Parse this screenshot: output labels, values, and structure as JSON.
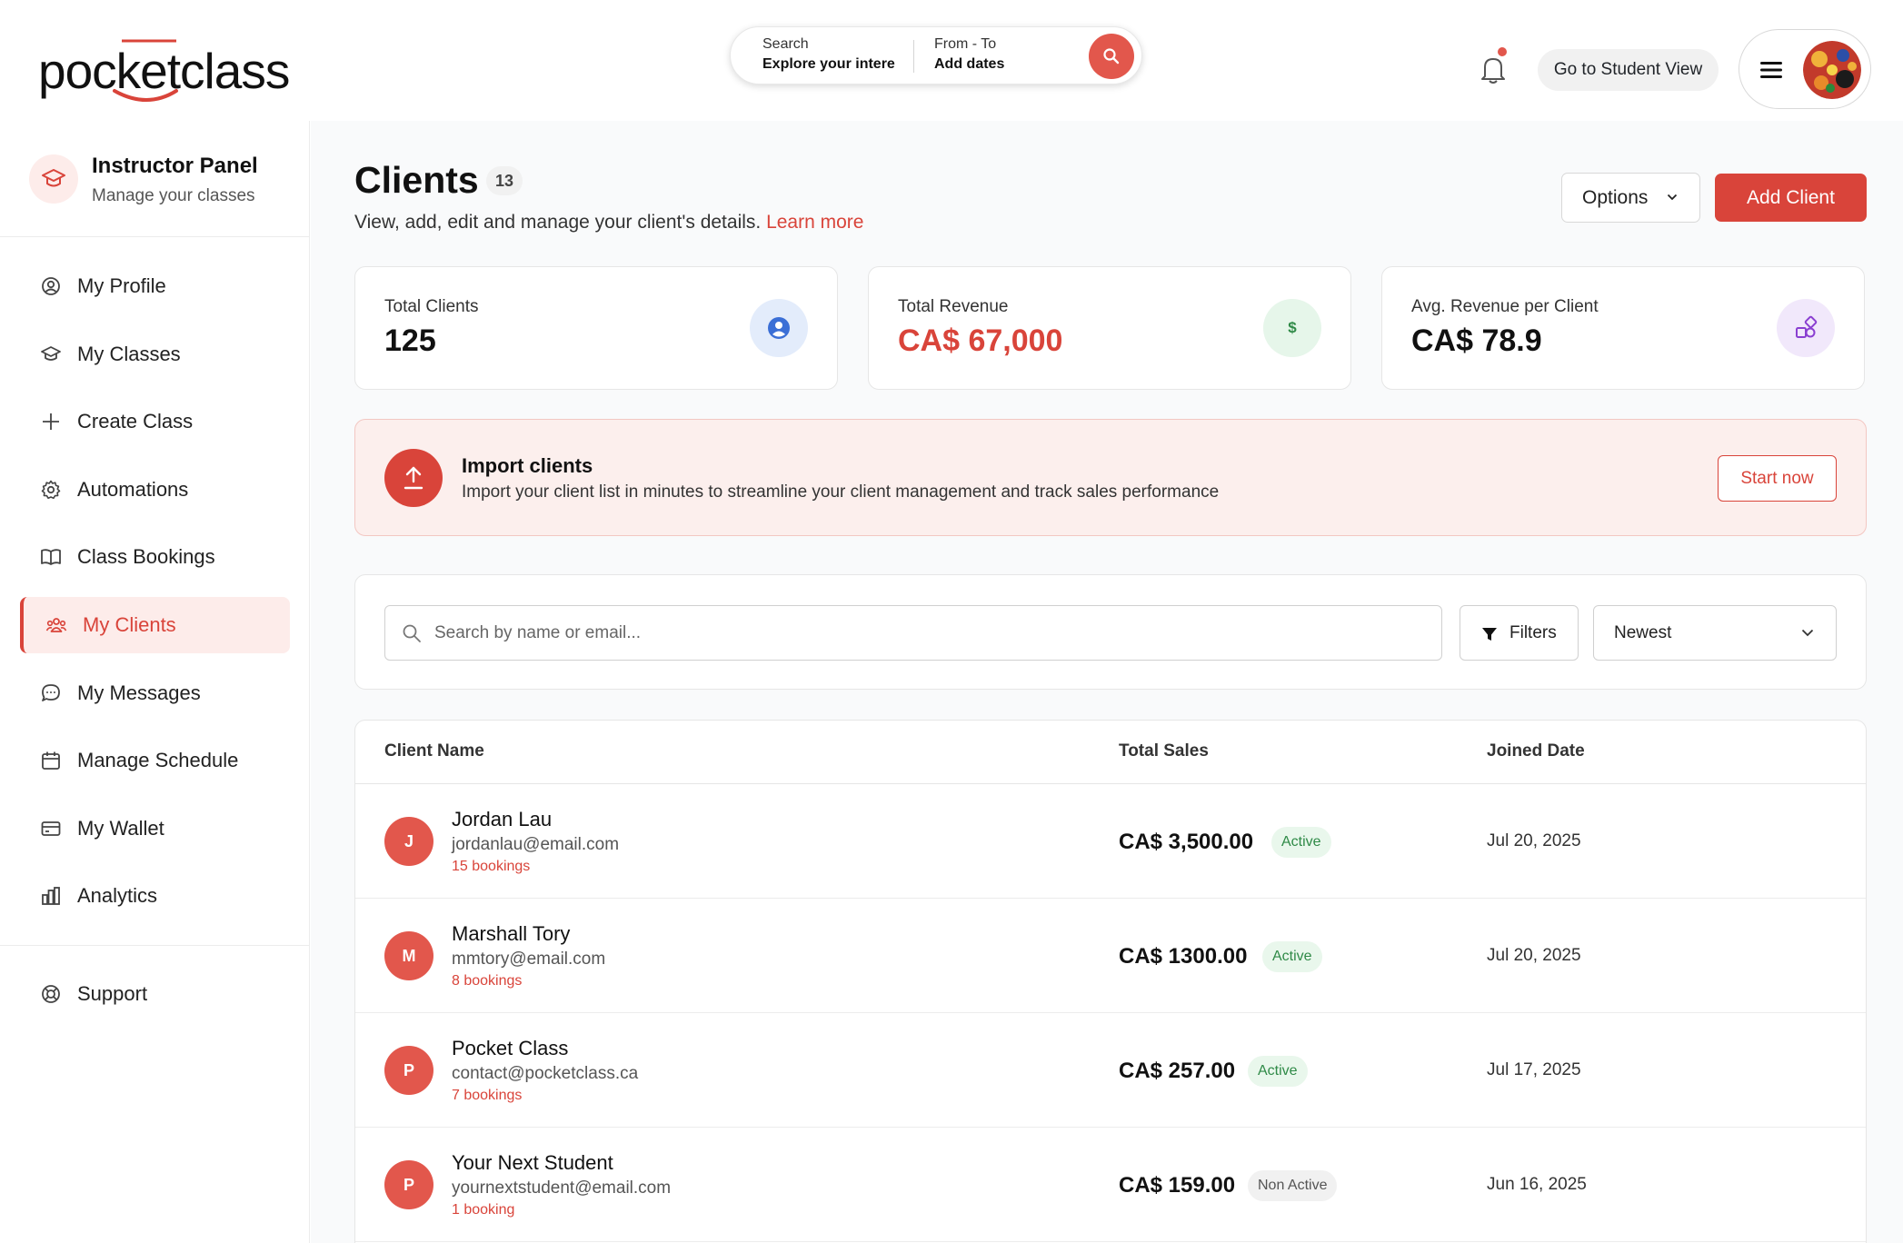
{
  "header": {
    "logo_text": "pocketclass",
    "search_label": "Search",
    "search_value": "Explore your intere",
    "dates_label": "From - To",
    "dates_value": "Add dates",
    "student_view_label": "Go to Student View"
  },
  "sidebar": {
    "panel_title": "Instructor Panel",
    "panel_subtitle": "Manage your classes",
    "items": [
      {
        "label": "My Profile",
        "icon": "user-circle-icon"
      },
      {
        "label": "My Classes",
        "icon": "graduation-cap-icon"
      },
      {
        "label": "Create Class",
        "icon": "plus-icon"
      },
      {
        "label": "Automations",
        "icon": "gear-icon"
      },
      {
        "label": "Class Bookings",
        "icon": "book-open-icon"
      },
      {
        "label": "My Clients",
        "icon": "users-icon",
        "active": true
      },
      {
        "label": "My Messages",
        "icon": "chat-bubble-icon"
      },
      {
        "label": "Manage Schedule",
        "icon": "calendar-icon"
      },
      {
        "label": "My Wallet",
        "icon": "wallet-icon"
      },
      {
        "label": "Analytics",
        "icon": "bar-chart-icon"
      }
    ],
    "support_label": "Support"
  },
  "main": {
    "title": "Clients",
    "count": "13",
    "subtitle": "View, add, edit and manage your client's details.",
    "learn_more": "Learn more",
    "options_label": "Options",
    "add_client_label": "Add Client",
    "stats": [
      {
        "label": "Total Clients",
        "value": "125",
        "icon": "user-circle-icon",
        "color": "#3b6fd6"
      },
      {
        "label": "Total Revenue",
        "value": "CA$ 67,000",
        "icon": "dollar-icon",
        "color": "#2f8a47"
      },
      {
        "label": "Avg. Revenue per Client",
        "value": "CA$ 78.9",
        "icon": "shapes-icon",
        "color": "#8a3fd1"
      }
    ],
    "import": {
      "title": "Import clients",
      "description": "Import your client list in minutes to streamline your client management and track sales performance",
      "button": "Start now"
    },
    "search_placeholder": "Search by name or email...",
    "filters_label": "Filters",
    "sort_value": "Newest",
    "table": {
      "headers": [
        "Client Name",
        "Total Sales",
        "Joined Date"
      ],
      "rows": [
        {
          "initial": "J",
          "name": "Jordan Lau",
          "email": "jordanlau@email.com",
          "bookings": "15 bookings",
          "sales": "CA$ 3,500.00",
          "status": "Active",
          "joined": "Jul 20, 2025"
        },
        {
          "initial": "M",
          "name": "Marshall Tory",
          "email": "mmtory@email.com",
          "bookings": "8 bookings",
          "sales": "CA$ 1300.00",
          "status": "Active",
          "joined": "Jul 20, 2025"
        },
        {
          "initial": "P",
          "name": "Pocket Class",
          "email": "contact@pocketclass.ca",
          "bookings": "7 bookings",
          "sales": "CA$ 257.00",
          "status": "Active",
          "joined": "Jul 17, 2025"
        },
        {
          "initial": "P",
          "name": "Your Next Student",
          "email": "yournextstudent@email.com",
          "bookings": "1 booking",
          "sales": "CA$ 159.00",
          "status": "Non Active",
          "joined": "Jun 16, 2025"
        }
      ]
    }
  },
  "colors": {
    "accent": "#d9443a",
    "accent_light": "#fdecea",
    "active_green": "#2f8a47"
  }
}
